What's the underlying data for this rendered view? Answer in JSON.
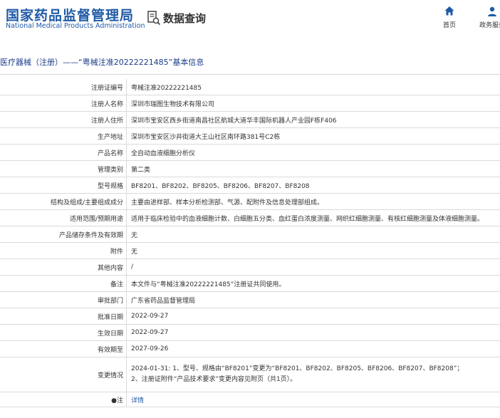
{
  "header": {
    "logo_cn": "国家药品监督管理局",
    "logo_en": "National Medical Products Administration",
    "section_title": "数据查询",
    "nav": [
      {
        "label": "首页",
        "icon": "home-icon"
      },
      {
        "label": "政务服务",
        "icon": "user-icon"
      }
    ],
    "brand_color": "#1f5aa6"
  },
  "page_title": "医疗器械（注册）——“粤械注准20222221485”基本信息",
  "fields": [
    {
      "key": "注册证编号",
      "value": "粤械注准20222221485"
    },
    {
      "key": "注册人名称",
      "value": "深圳市瑞图生物技术有限公司"
    },
    {
      "key": "注册人住所",
      "value": "深圳市宝安区西乡街道南昌社区航城大道华丰国际机器人产业园F栋F406"
    },
    {
      "key": "生产地址",
      "value": "深圳市宝安区沙井街道大王山社区南环路381号C2栋"
    },
    {
      "key": "产品名称",
      "value": "全自动血液细胞分析仪"
    },
    {
      "key": "管理类别",
      "value": "第二类"
    },
    {
      "key": "型号规格",
      "value": "BF8201、BF8202、BF8205、BF8206、BF8207、BF8208"
    },
    {
      "key": "结构及组成/主要组成成分",
      "value": "主要由进样部、样本分析检测部、气源、配附件及信息处理部组成。"
    },
    {
      "key": "适用范围/预期用途",
      "value": "适用于临床检验中的血液细胞计数、白细胞五分类、血红蛋白浓度测量、网织红细胞测量、有核红细胞测量及体液细胞测量。"
    },
    {
      "key": "产品储存条件及有效期",
      "value": "无"
    },
    {
      "key": "附件",
      "value": "无"
    },
    {
      "key": "其他内容",
      "value": "/"
    },
    {
      "key": "备注",
      "value": "本文件与“粤械注准20222221485”注册证共同使用。"
    },
    {
      "key": "审批部门",
      "value": "广东省药品监督管理局"
    },
    {
      "key": "批准日期",
      "value": "2022-09-27"
    },
    {
      "key": "生效日期",
      "value": "2022-09-27"
    },
    {
      "key": "有效期至",
      "value": "2027-09-26"
    },
    {
      "key": "变更情况",
      "value_lines": [
        "2024-01-31: 1、型号、规格由“BF8201”变更为“BF8201、BF8202、BF8205、BF8206、BF8207、BF8208”；",
        "2、注册证附件“产品技术要求”变更内容见附页（共1页）。"
      ]
    },
    {
      "key": "●注",
      "value": "详情"
    }
  ]
}
